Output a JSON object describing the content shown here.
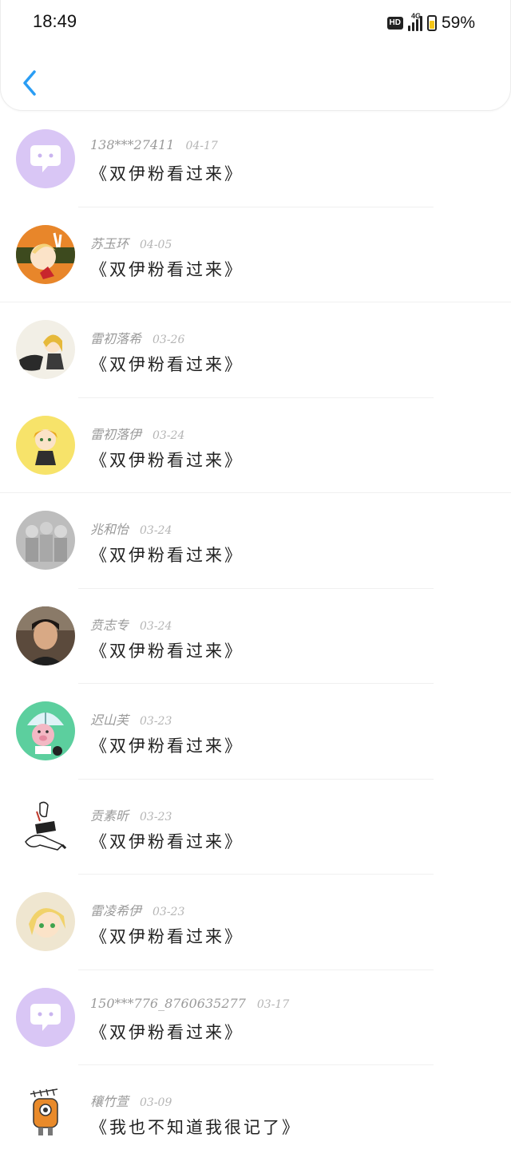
{
  "status_bar": {
    "time": "18:49",
    "hd_label": "HD",
    "network_label": "4G",
    "battery_text": "59%"
  },
  "header": {
    "back_icon": "chevron-left-icon",
    "accent_color": "#2a9df4"
  },
  "comments": [
    {
      "name": "138***27411",
      "date": "04-17",
      "text": "《双伊粉看过来》",
      "avatar": "chat-bubble-icon"
    },
    {
      "name": "苏玉环",
      "date": "04-05",
      "text": "《双伊粉看过来》",
      "avatar": "anime-character-avatar"
    },
    {
      "name": "雷初落希",
      "date": "03-26",
      "text": "《双伊粉看过来》",
      "avatar": "anime-character-avatar"
    },
    {
      "name": "雷初落伊",
      "date": "03-24",
      "text": "《双伊粉看过来》",
      "avatar": "anime-character-avatar"
    },
    {
      "name": "兆和怡",
      "date": "03-24",
      "text": "《双伊粉看过来》",
      "avatar": "sketch-avatar"
    },
    {
      "name": "贲志专",
      "date": "03-24",
      "text": "《双伊粉看过来》",
      "avatar": "photo-avatar"
    },
    {
      "name": "迟山芙",
      "date": "03-23",
      "text": "《双伊粉看过来》",
      "avatar": "cartoon-pig-avatar"
    },
    {
      "name": "贡素昕",
      "date": "03-23",
      "text": "《双伊粉看过来》",
      "avatar": "sketch-avatar"
    },
    {
      "name": "雷凌希伊",
      "date": "03-23",
      "text": "《双伊粉看过来》",
      "avatar": "anime-character-avatar"
    },
    {
      "name": "150***776_8760635277",
      "date": "03-17",
      "text": "《双伊粉看过来》",
      "avatar": "chat-bubble-icon"
    },
    {
      "name": "穰竹萱",
      "date": "03-09",
      "text": "《我也不知道我很记了》",
      "avatar": "robot-avatar"
    }
  ]
}
